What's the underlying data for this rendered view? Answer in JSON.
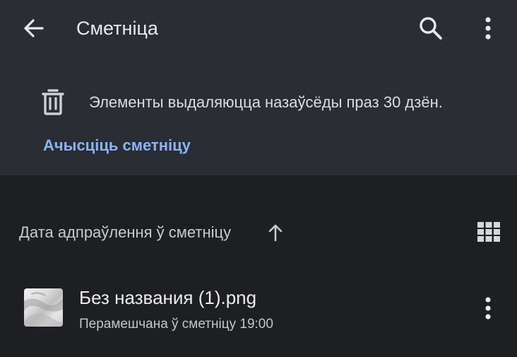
{
  "appbar": {
    "title": "Сметніца",
    "back_icon": "arrow-left-icon",
    "search_icon": "search-icon",
    "more_icon": "more-vert-icon"
  },
  "notice": {
    "icon": "trash-icon",
    "text": "Элементы выдаляюцца назаўсёды праз 30 дзён.",
    "empty_trash_label": "Ачысціць сметніцу"
  },
  "sort": {
    "label": "Дата адпраўлення ў сметніцу",
    "direction_icon": "arrow-up-icon",
    "view_toggle_icon": "grid-view-icon"
  },
  "files": [
    {
      "name": "Без названия (1).png",
      "meta": "Перамешчана ў сметніцу 19:00",
      "thumbnail_icon": "image-thumbnail",
      "more_icon": "more-vert-icon"
    }
  ],
  "colors": {
    "header_bg": "#2a2d33",
    "page_bg": "#1e1f23",
    "accent": "#8ab4f8",
    "text_primary": "#e6e6e8",
    "text_secondary": "#c4c5c8"
  }
}
